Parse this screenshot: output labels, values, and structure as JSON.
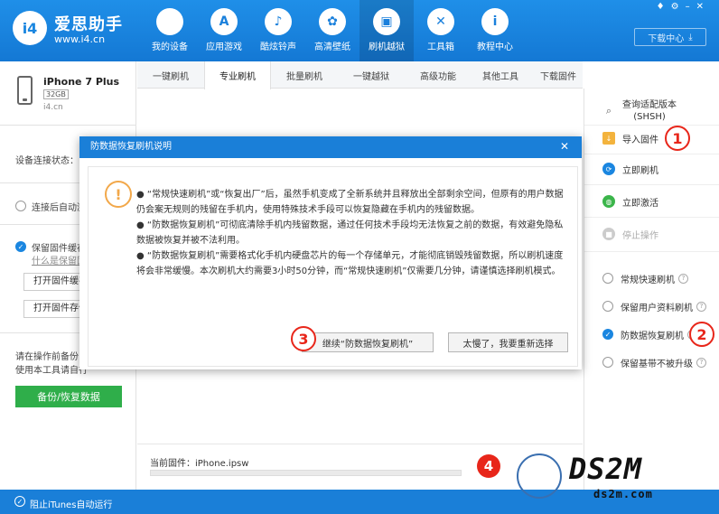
{
  "app": {
    "logo_mark": "i4",
    "name": "爱思助手",
    "url": "www.i4.cn",
    "download_center": "下载中心"
  },
  "nav": [
    {
      "label": "我的设备",
      "icon": "apple-icon"
    },
    {
      "label": "应用游戏",
      "icon": "app-store-icon"
    },
    {
      "label": "酷炫铃声",
      "icon": "bell-icon"
    },
    {
      "label": "高清壁纸",
      "icon": "flower-icon"
    },
    {
      "label": "刷机越狱",
      "icon": "box-icon"
    },
    {
      "label": "工具箱",
      "icon": "tools-icon"
    },
    {
      "label": "教程中心",
      "icon": "info-icon"
    }
  ],
  "active_nav_index": 4,
  "device": {
    "name": "iPhone 7 Plus",
    "storage": "32GB",
    "source": "i4.cn"
  },
  "left_panel": {
    "connection_status_label": "设备连接状态：",
    "auto_activate_label": "连接后自动激",
    "keep_firmware_label": "保留固件缓存",
    "where_firmware_link": "什么是保留固",
    "open_firmware_dir_btn": "打开固件缓存",
    "open_firmware_store_btn": "打开固件存储",
    "note_line1": "请在操作前备份",
    "note_line2": "使用本工具请自行",
    "backup_btn": "备份/恢复数据"
  },
  "tabs": [
    "一键刷机",
    "专业刷机",
    "批量刷机",
    "一键越狱",
    "高级功能",
    "其他工具",
    "下载固件"
  ],
  "active_tab_index": 1,
  "right_panel": {
    "actions": [
      {
        "label": "查询适配版本(SHSH)",
        "label_line1": "查询适配版本",
        "label_line2": "(SHSH)",
        "icon": "search-icon"
      },
      {
        "label": "导入固件",
        "icon": "folder-import-icon"
      },
      {
        "label": "立即刷机",
        "icon": "flash-icon"
      },
      {
        "label": "立即激活",
        "icon": "globe-icon"
      },
      {
        "label": "停止操作",
        "icon": "stop-icon"
      }
    ],
    "modes": [
      {
        "label": "常规快速刷机",
        "selected": false
      },
      {
        "label": "保留用户资料刷机",
        "selected": false
      },
      {
        "label": "防数据恢复刷机",
        "selected": true
      },
      {
        "label": "保留基带不被升级",
        "selected": false
      }
    ]
  },
  "firmware": {
    "label": "当前固件：iPhone.ipsw"
  },
  "bottom_bar": {
    "itunes_label": "阻止iTunes自动运行"
  },
  "dialog": {
    "title": "防数据恢复刷机说明",
    "paragraph1": "●  “常规快速刷机”或“恢复出厂”后，虽然手机变成了全新系统并且释放出全部剩余空间，但原有的用户数据仍会案无规则的残留在手机内，使用特殊技术手段可以恢复隐藏在手机内的残留数据。",
    "paragraph2": "●  “防数据恢复刷机”可彻底清除手机内残留数据，通过任何技术手段均无法恢复之前的数据，有效避免隐私数据被恢复并被不法利用。",
    "paragraph3": "●  “防数据恢复刷机”需要格式化手机内硬盘芯片的每一个存储单元，才能彻底销毁残留数据，所以刷机速度将会非常缓慢。本次刷机大约需要3小时50分钟，而“常规快速刷机”仅需要几分钟，请谨慎选择刷机模式。",
    "continue_btn": "继续“防数据恢复刷机”",
    "too_slow_btn": "太慢了，我要重新选择"
  },
  "step_markers": {
    "one": "1",
    "two": "2",
    "three": "3",
    "four": "4"
  },
  "watermark": {
    "text": "DS2M",
    "sub": "ds2m.com"
  },
  "colors": {
    "brand_blue": "#1a7fd8",
    "green": "#2fae4a",
    "warning_orange": "#f2a84a",
    "marker_red": "#e8261a"
  }
}
